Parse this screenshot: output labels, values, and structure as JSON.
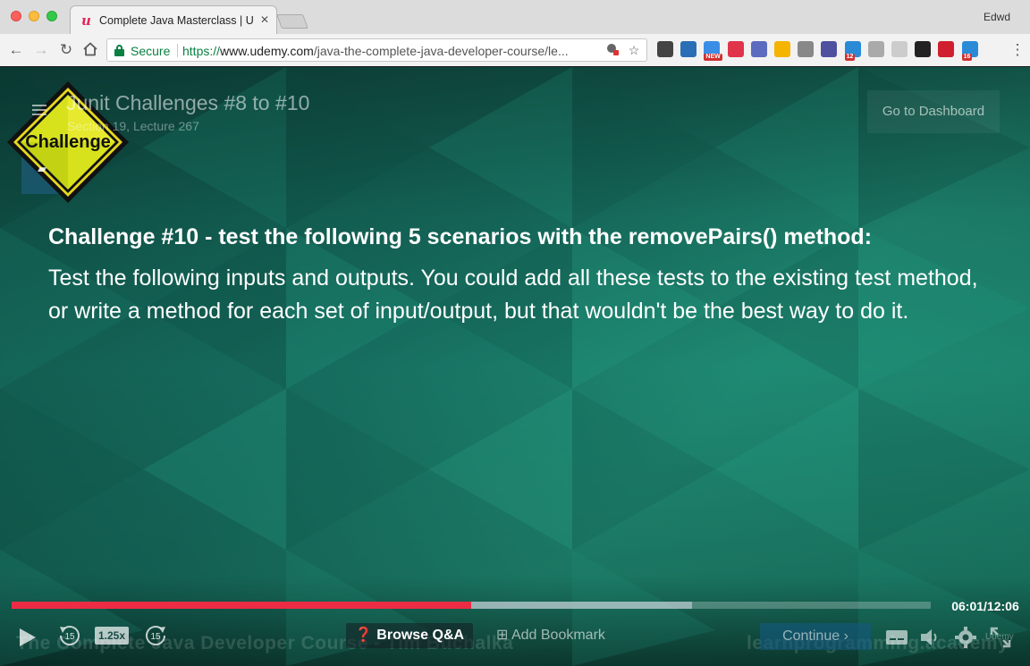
{
  "browser": {
    "tab_title": "Complete Java Masterclass | Udemy",
    "tab_favicon": "udemy-logo",
    "profile_name": "Edwd",
    "secure_label": "Secure",
    "url_scheme": "https://",
    "url_host": "www.udemy.com",
    "url_path": "/java-the-complete-java-developer-course/le..."
  },
  "extensions": [
    {
      "name": "evernote-icon",
      "color": "#444444",
      "badge": ""
    },
    {
      "name": "s-icon",
      "color": "#2a6fb5",
      "badge": ""
    },
    {
      "name": "new-icon",
      "color": "#3a8ee6",
      "badge": "NEW"
    },
    {
      "name": "pocket-icon",
      "color": "#e0344a",
      "badge": ""
    },
    {
      "name": "swirl-icon",
      "color": "#5c6bc0",
      "badge": ""
    },
    {
      "name": "colorful-icon",
      "color": "#f4b400",
      "badge": ""
    },
    {
      "name": "gear-ext-icon",
      "color": "#888888",
      "badge": ""
    },
    {
      "name": "block-icon",
      "color": "#5050a0",
      "badge": ""
    },
    {
      "name": "s2-icon",
      "color": "#2a8ad6",
      "badge": "12"
    },
    {
      "name": "scissors-icon",
      "color": "#aaaaaa",
      "badge": ""
    },
    {
      "name": "moon-icon",
      "color": "#cccccc",
      "badge": ""
    },
    {
      "name": "grid-icon",
      "color": "#222222",
      "badge": ""
    },
    {
      "name": "t-icon",
      "color": "#d02030",
      "badge": ""
    },
    {
      "name": "calendar-icon",
      "color": "#2a8ad6",
      "badge": "16"
    }
  ],
  "lecture": {
    "title": "Junit Challenges #8 to #10",
    "subtitle": "Section 19, Lecture 267",
    "dashboard_label": "Go to Dashboard",
    "sign_text": "Challenge"
  },
  "slide": {
    "heading": "Challenge #10 - test the following 5 scenarios with the removePairs() method:",
    "body": "Test the following inputs and outputs. You could add all these tests to the existing test method, or write a method for each set of input/output, but that wouldn't be the best way to do it."
  },
  "player": {
    "played_fraction": 0.5,
    "buffered_fraction": 0.74,
    "time": "06:01/12:06",
    "speed": "1.25x",
    "skip_back": "15",
    "skip_forward": "15",
    "browse_qa": "Browse Q&A",
    "add_bookmark": "Add Bookmark",
    "continue": "Continue",
    "watermark_left": "The Complete Java Developer Course - Tim Buchalka",
    "watermark_right": "learnprogramming.academy",
    "brand": "Udemy"
  },
  "colors": {
    "progress_played": "#ec2c45",
    "secure_green": "#0b8043",
    "udemy_red": "#e0285b"
  }
}
